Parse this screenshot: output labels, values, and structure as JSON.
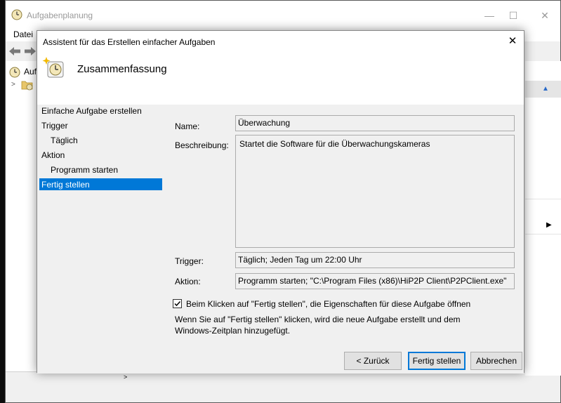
{
  "main_window": {
    "title": "Aufgabenplanung",
    "min_glyph": "—",
    "max_glyph": "☐",
    "close_glyph": "✕",
    "menu": {
      "datei": "Datei"
    },
    "tree": {
      "root_label": "Auf",
      "toggle_glyph": ">"
    },
    "side_strip": "& e"
  },
  "wizard": {
    "title": "Assistent für das Erstellen einfacher Aufgaben",
    "close_glyph": "✕",
    "heading": "Zusammenfassung",
    "steps": [
      {
        "label": "Einfache Aufgabe erstellen"
      },
      {
        "label": "Trigger"
      },
      {
        "label": "Täglich"
      },
      {
        "label": "Aktion"
      },
      {
        "label": "Programm starten"
      },
      {
        "label": "Fertig stellen",
        "selected": true
      }
    ],
    "fields": {
      "name_label": "Name:",
      "name_value": "Überwachung",
      "desc_label": "Beschreibung:",
      "desc_value": "Startet die Software für die Überwachungskameras",
      "trigger_label": "Trigger:",
      "trigger_value": "Täglich; Jeden Tag um 22:00 Uhr",
      "action_label": "Aktion:",
      "action_value": "Programm starten; \"C:\\Program Files (x86)\\HiP2P Client\\P2PClient.exe\""
    },
    "checkbox": {
      "label": "Beim Klicken auf \"Fertig stellen\", die Eigenschaften für diese Aufgabe öffnen",
      "checked": true
    },
    "info": "Wenn Sie auf \"Fertig stellen\" klicken, wird die neue Aufgabe erstellt und dem Windows-Zeitplan hinzugefügt.",
    "buttons": {
      "back": "< Zurück",
      "finish": "Fertig stellen",
      "cancel": "Abbrechen"
    }
  },
  "colors": {
    "selection": "#0078d7",
    "dialog_body": "#f0f0f0",
    "field_border": "#acacac"
  },
  "icons": {
    "app": "clock-icon",
    "wizard_header": "clock-sparkle-icon",
    "folder": "folder-clock-icon"
  }
}
